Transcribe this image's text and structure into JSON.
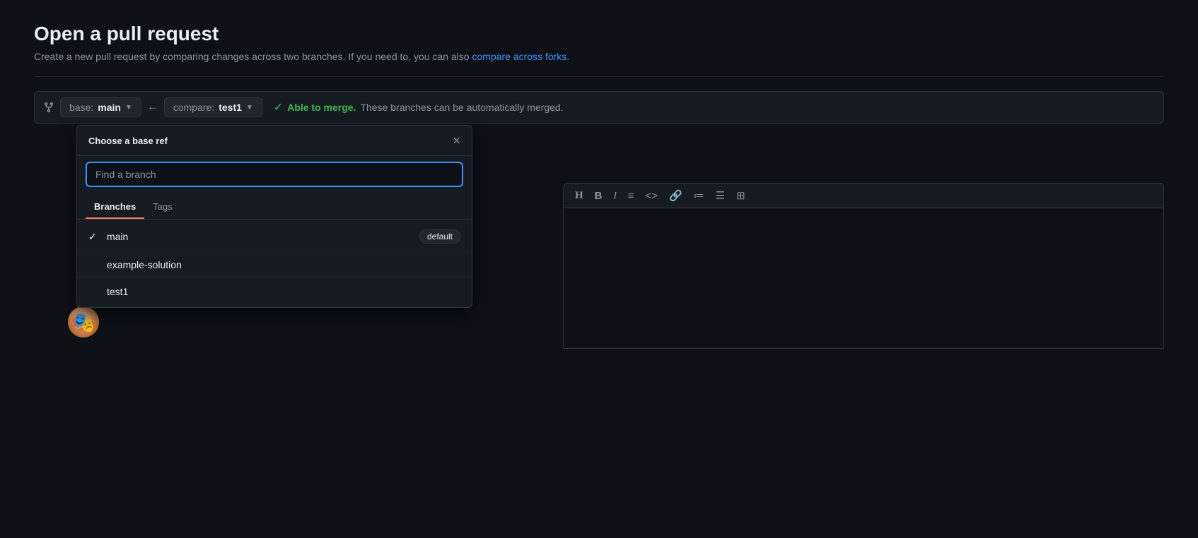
{
  "page": {
    "title": "Open a pull request",
    "subtitle": "Create a new pull request by comparing changes across two branches. If you need to, you can also",
    "subtitle_link_text": "compare across forks.",
    "subtitle_link_href": "#"
  },
  "branch_bar": {
    "compare_icon": "⇄",
    "base_label": "base:",
    "base_branch": "main",
    "arrow": "←",
    "compare_label": "compare:",
    "compare_branch": "test1",
    "merge_check_icon": "✓",
    "able_to_merge_text": "Able to merge.",
    "auto_merge_text": "These branches can be automatically merged."
  },
  "dropdown": {
    "title": "Choose a base ref",
    "close_label": "×",
    "search_placeholder": "Find a branch",
    "tabs": [
      {
        "id": "branches",
        "label": "Branches",
        "active": true
      },
      {
        "id": "tags",
        "label": "Tags",
        "active": false
      }
    ],
    "branches": [
      {
        "name": "main",
        "selected": true,
        "badge": "default"
      },
      {
        "name": "example-solution",
        "selected": false,
        "badge": null
      },
      {
        "name": "test1",
        "selected": false,
        "badge": null
      }
    ]
  },
  "editor": {
    "toolbar_icons": [
      "H",
      "B",
      "I",
      "≡",
      "<>",
      "🔗",
      "•≡",
      "1≡",
      "≡≡"
    ]
  }
}
